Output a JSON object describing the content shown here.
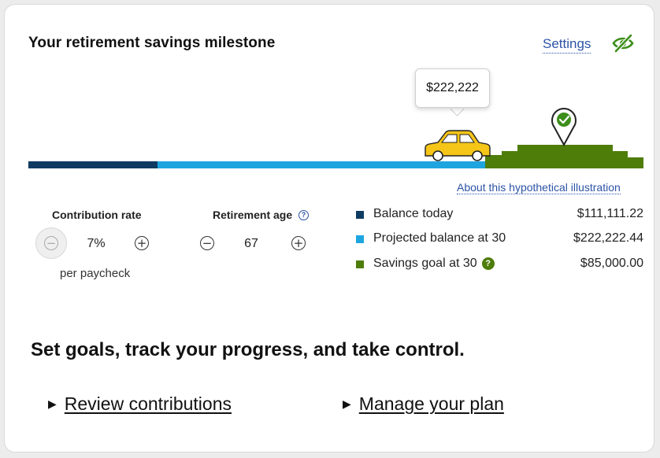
{
  "card": {
    "title": "Your retirement savings milestone",
    "settings_label": "Settings",
    "visibility_icon": "eye-slash-icon"
  },
  "illustration": {
    "tooltip_value": "$222,222",
    "about_link": "About this hypothetical illustration",
    "car_icon": "car-icon",
    "goal_marker_icon": "map-pin-check-icon",
    "colors": {
      "balance_today": "#0f3b62",
      "projected": "#1ea5e0",
      "goal": "#4e7d0a",
      "car": "#f5c518"
    }
  },
  "controls": {
    "contribution": {
      "label": "Contribution rate",
      "value": "7%",
      "sub_label": "per paycheck",
      "minus_disabled": true
    },
    "retirement_age": {
      "label": "Retirement age",
      "value": "67",
      "help_icon": "question-circle-icon"
    }
  },
  "legend": [
    {
      "label": "Balance today",
      "amount": "$111,111.22",
      "color": "#0f3b62"
    },
    {
      "label": "Projected balance at 30",
      "amount": "$222,222.44",
      "color": "#1ea5e0"
    },
    {
      "label": "Savings goal at 30",
      "amount": "$85,000.00",
      "color": "#4e7d0a",
      "help": "?"
    }
  ],
  "cta": {
    "tagline": "Set goals, track your progress, and take control.",
    "links": [
      "Review contributions",
      "Manage your plan"
    ]
  }
}
